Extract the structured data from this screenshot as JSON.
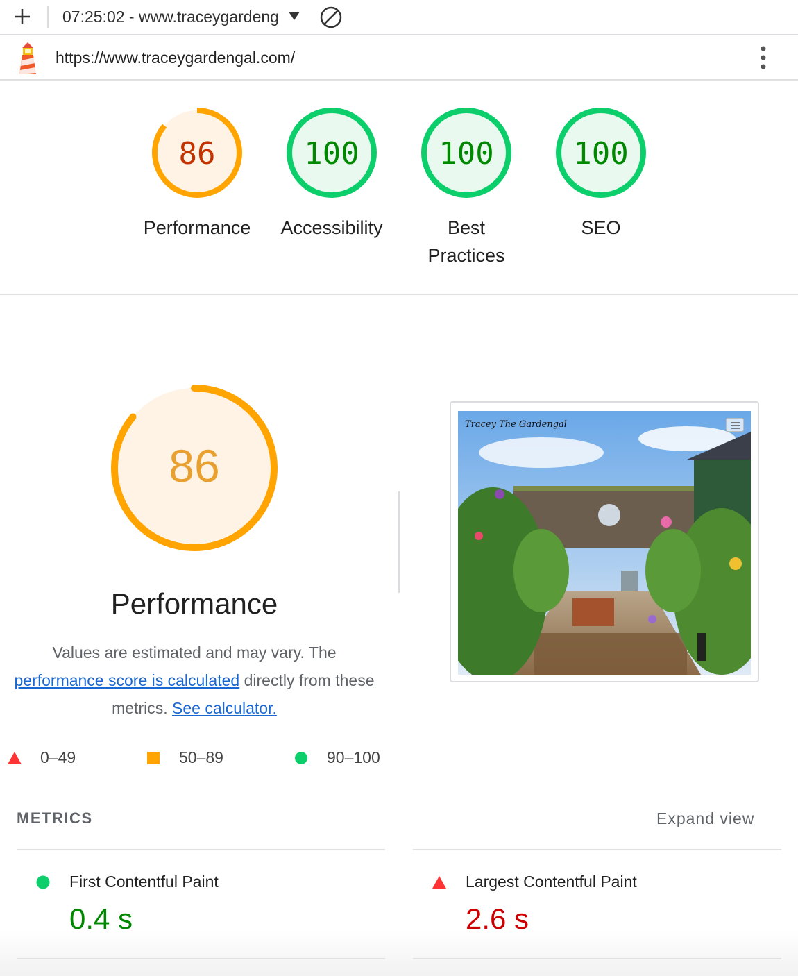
{
  "toolbar": {
    "title": "07:25:02 - www.traceygardeng",
    "new_report_icon": "plus-icon",
    "dropdown_icon": "caret-down-icon",
    "clear_icon": "clear-circle-icon"
  },
  "urlbar": {
    "url": "https://www.traceygardengal.com/",
    "logo_icon": "lighthouse-logo-icon",
    "menu_icon": "kebab-menu-icon"
  },
  "gauges": [
    {
      "score": "86",
      "label": "Performance",
      "rating": "average",
      "value": 0.86
    },
    {
      "score": "100",
      "label": "Accessibility",
      "rating": "pass",
      "value": 1.0
    },
    {
      "score": "100",
      "label": "Best Practices",
      "rating": "pass",
      "value": 1.0
    },
    {
      "score": "100",
      "label": "SEO",
      "rating": "pass",
      "value": 1.0
    }
  ],
  "performance": {
    "score": "86",
    "value": 0.86,
    "title": "Performance",
    "desc_part1": "Values are estimated and may vary. The",
    "desc_link1": "performance score is calculated",
    "desc_part2": "directly from these metrics.",
    "desc_link2": "See calculator."
  },
  "screenshot": {
    "brand_text": "Tracey The Gardengal"
  },
  "legend": [
    {
      "range": "0–49",
      "shape": "triangle",
      "color": "#ff3333"
    },
    {
      "range": "50–89",
      "shape": "square",
      "color": "#ffa400"
    },
    {
      "range": "90–100",
      "shape": "circle",
      "color": "#0cce6b"
    }
  ],
  "metrics": {
    "header": "METRICS",
    "expand_label": "Expand view",
    "items": [
      {
        "title": "First Contentful Paint",
        "value": "0.4 s",
        "rating": "pass",
        "color": "#008800"
      },
      {
        "title": "Largest Contentful Paint",
        "value": "2.6 s",
        "rating": "fail",
        "color": "#cc0000"
      }
    ]
  },
  "colors": {
    "pass": "#0cce6b",
    "pass_text": "#008800",
    "average": "#ffa400",
    "average_text": "#c33300",
    "fail": "#ff3333",
    "link": "#1967d2"
  }
}
